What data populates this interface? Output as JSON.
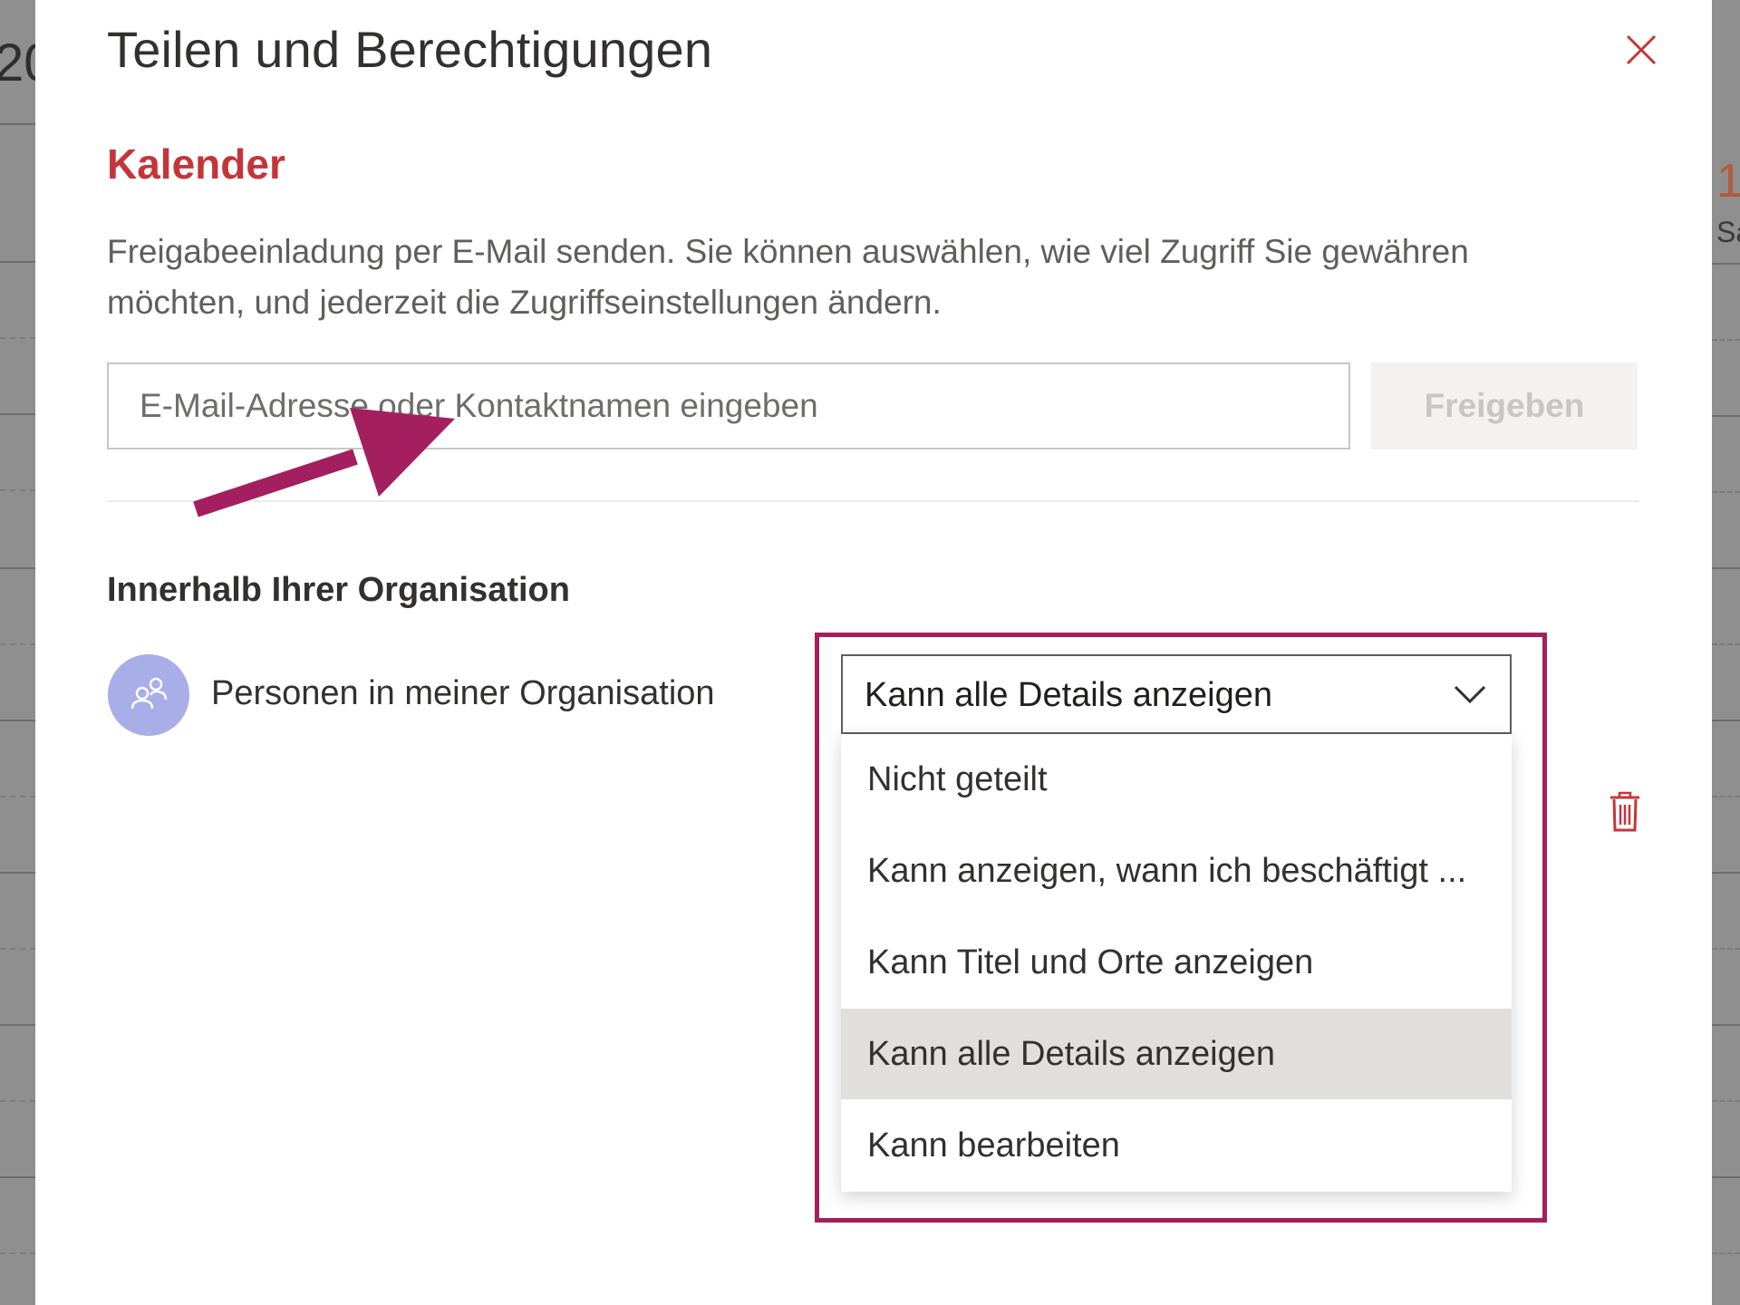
{
  "background": {
    "left_fragment": "20",
    "right_number": "1",
    "right_day": "Sa"
  },
  "dialog": {
    "title": "Teilen und Berechtigungen",
    "close_icon": "close-icon",
    "section_title": "Kalender",
    "description": "Freigabeeinladung per E-Mail senden. Sie können auswählen, wie viel Zugriff Sie gewähren möchten, und jederzeit die Zugriffseinstellungen ändern.",
    "email_input": {
      "value": "",
      "placeholder": "E-Mail-Adresse oder Kontaktnamen eingeben"
    },
    "share_button": "Freigeben",
    "organization": {
      "heading": "Innerhalb Ihrer Organisation",
      "entry_label": "Personen in meiner Organisation",
      "avatar_icon": "people-icon",
      "permission": {
        "selected": "Kann alle Details anzeigen",
        "options": [
          "Nicht geteilt",
          "Kann anzeigen, wann ich beschäftigt ...",
          "Kann Titel und Orte anzeigen",
          "Kann alle Details anzeigen",
          "Kann bearbeiten"
        ],
        "selected_index": 3
      },
      "delete_icon": "trash-icon"
    }
  },
  "colors": {
    "accent_red": "#c4353a",
    "annotation": "#a31f5f",
    "avatar_bg": "#a9ade8",
    "selected_item_bg": "#e1dfdd"
  }
}
